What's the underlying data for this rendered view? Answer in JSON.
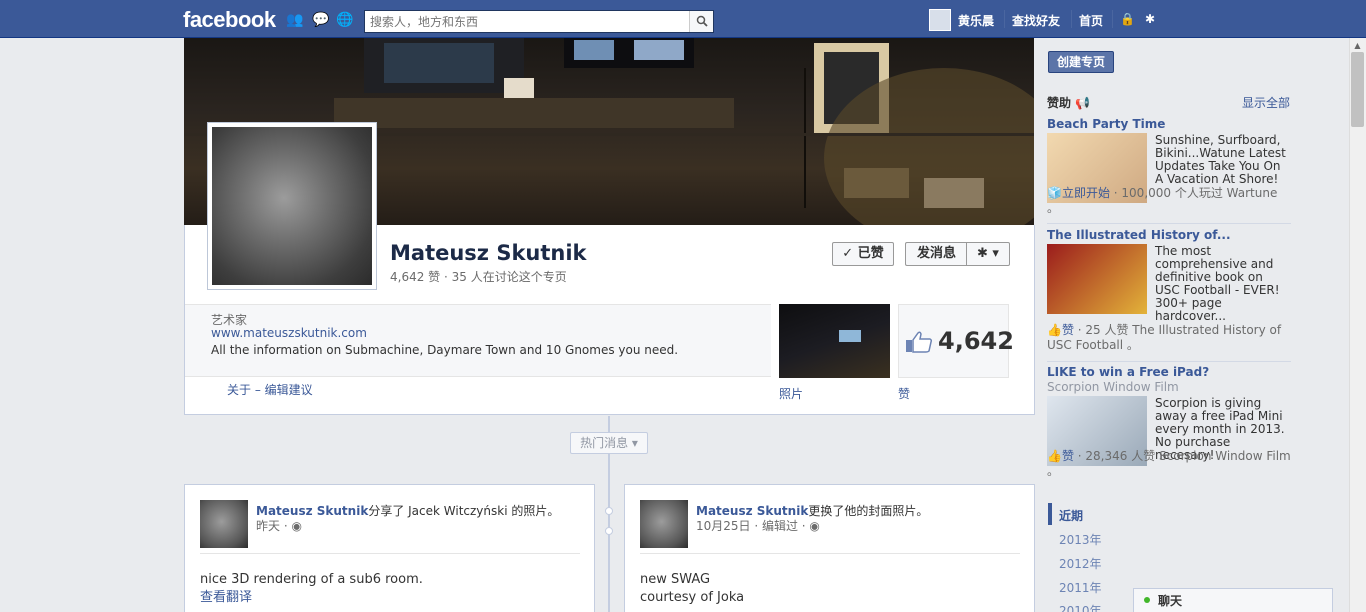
{
  "topbar": {
    "logo": "facebook",
    "search_placeholder": "搜索人，地方和东西",
    "user_name": "黄乐晨",
    "find_friends": "查找好友",
    "home": "首页"
  },
  "profile": {
    "name": "Mateusz Skutnik",
    "stats": "4,642 赞 · 35 人在讨论这个专页",
    "liked_button": "✓ 已赞",
    "message_button": "发消息",
    "category": "艺术家",
    "website": "www.mateuszskutnik.com",
    "description": "All the information on Submachine, Daymare Town and 10 Gnomes you need.",
    "about_links": "关于 – 编辑建议",
    "likes_count": "4,642",
    "photos_label": "照片",
    "likes_label": "赞"
  },
  "timeline": {
    "highlights": "热门消息 ▾",
    "posts": [
      {
        "author": "Mateusz Skutnik",
        "action": "分享了 Jacek Witczyński 的照片。",
        "meta": "昨天 · ◉",
        "body1": "nice 3D rendering of a sub6 room.",
        "body2": "查看翻译"
      },
      {
        "author": "Mateusz Skutnik",
        "action": "更换了他的封面照片。",
        "meta": "10月25日 · 编辑过 · ◉",
        "body1": "new SWAG",
        "body2": "courtesy of Joka"
      }
    ]
  },
  "sidebar": {
    "create_page": "创建专页",
    "sponsored": "赞助 📢",
    "show_all": "显示全部",
    "ads": [
      {
        "title": "Beach Party Time",
        "text": "Sunshine, Surfboard, Bikini...Watune Latest Updates Take You On A Vacation At Shore!",
        "cta": "立即开始",
        "foot": " · 100,000 个人玩过 Wartune 。"
      },
      {
        "title": "The Illustrated History of...",
        "text": "The most comprehensive and definitive book on USC Football - EVER! 300+ page hardcover...",
        "cta": "赞",
        "foot": " · 25 人赞 The Illustrated History of USC Football 。"
      },
      {
        "title": "LIKE to win a Free iPad?",
        "subtitle": "Scorpion Window Film",
        "text": "Scorpion is giving away a free iPad Mini every month in 2013. No purchase necesary!",
        "cta": "赞",
        "foot": " · 28,346 人赞 Scorpion Window Film 。"
      }
    ],
    "years": [
      "近期",
      "2013年",
      "2012年",
      "2011年",
      "2010年"
    ]
  },
  "chat": {
    "label": "聊天"
  },
  "colors": {
    "brand": "#3b5998",
    "background": "#e9ebee"
  }
}
